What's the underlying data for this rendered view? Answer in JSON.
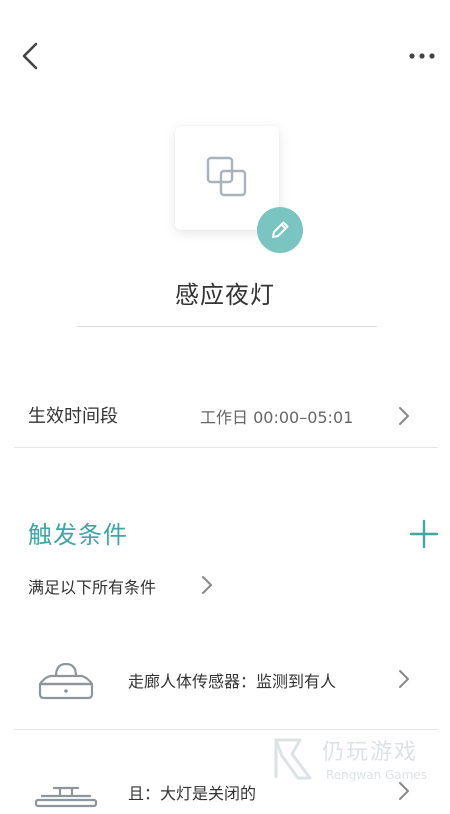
{
  "header": {
    "back_icon": "chevron-left-icon",
    "more_icon": "more-horizontal-icon"
  },
  "scene": {
    "name": "感应夜灯",
    "icon": "scene-squares-icon",
    "edit_icon": "pencil-icon",
    "accent": "#7ac4c2"
  },
  "schedule": {
    "label": "生效时间段",
    "value": "工作日 00:00–05:01"
  },
  "triggers": {
    "title": "触发条件",
    "title_color": "#3fa6a4",
    "mode_label": "满足以下所有条件",
    "items": [
      {
        "device_icon": "motion-sensor-icon",
        "text": "走廊人体传感器：监测到有人"
      },
      {
        "device_icon": "ceiling-light-icon",
        "text": "且：大灯是关闭的"
      }
    ]
  },
  "watermark": {
    "cn": "仍玩游戏",
    "en": "Rengwan Games"
  }
}
